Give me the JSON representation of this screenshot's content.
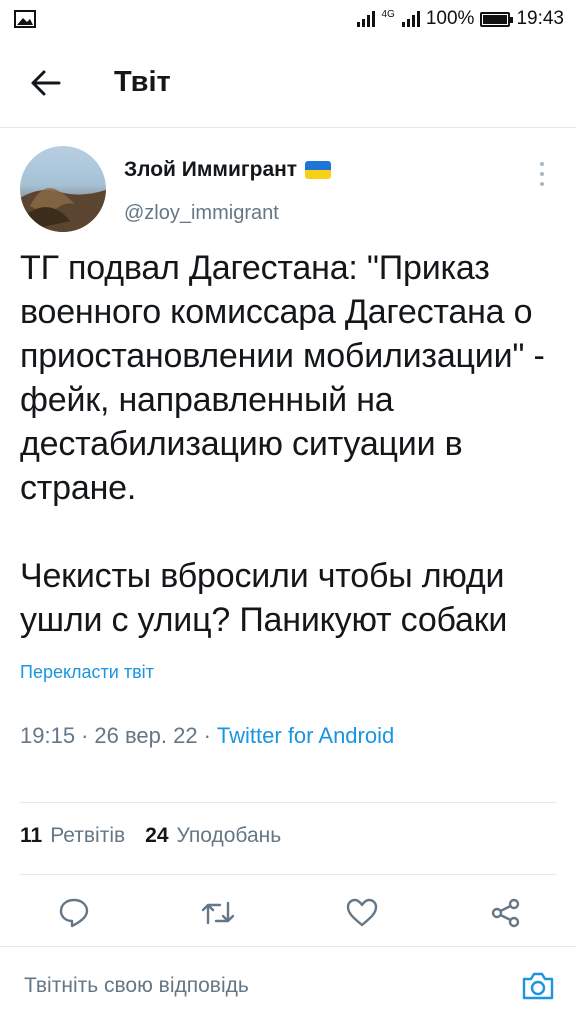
{
  "status_bar": {
    "network": "4G",
    "battery": "100%",
    "time": "19:43"
  },
  "header": {
    "title": "Твіт",
    "back_icon": "arrow-left-icon"
  },
  "tweet": {
    "author_name": "Злой Иммигрант",
    "author_flag_colors": [
      "#1d75d6",
      "#f7d117"
    ],
    "handle": "@zloy_immigrant",
    "text": "ТГ подвал Дагестана: \"Приказ военного комиссара Дагестана о приостановлении мобилизации\" - фейк, направленный на дестабилизацию ситуации в стране.\n\nЧекисты вбросили чтобы люди ушли с улиц? Паникуют собаки",
    "translate_label": "Перекласти твіт",
    "time": "19:15",
    "date": "26 вер. 22",
    "source": "Twitter for Android"
  },
  "stats": {
    "retweets_count": "11",
    "retweets_label": "Ретвітів",
    "likes_count": "24",
    "likes_label": "Уподобань"
  },
  "actions": {
    "icons": [
      "reply-icon",
      "retweet-icon",
      "like-icon",
      "share-icon"
    ]
  },
  "reply": {
    "placeholder": "Твітніть свою відповідь",
    "camera_icon": "camera-icon"
  },
  "colors": {
    "accent": "#1b95e0",
    "secondary_text": "#657786",
    "divider": "#e1e8ed"
  }
}
